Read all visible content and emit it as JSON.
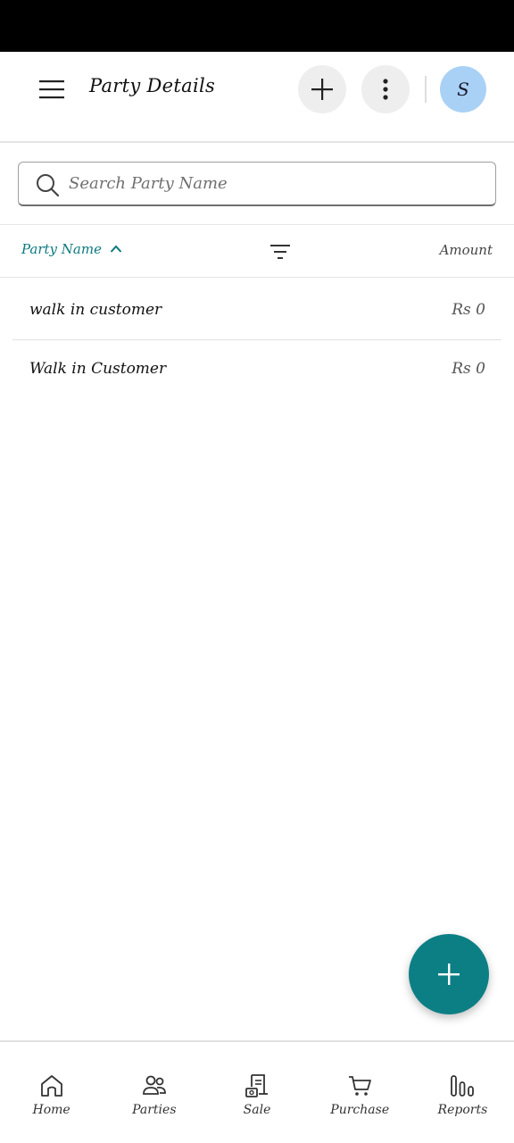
{
  "app_bar": {
    "title": "Party Details",
    "avatar_initial": "S",
    "avatar_color": "#a9d1f5"
  },
  "icons": {
    "menu": "hamburger-menu-icon",
    "add": "plus-icon",
    "more": "vertical-dots-icon",
    "search": "search-icon",
    "sort": "chevron-up-icon",
    "filter": "filter-lines-icon",
    "fab": "plus-icon"
  },
  "search": {
    "placeholder": "Search Party Name",
    "value": ""
  },
  "list_header": {
    "name_column": "Party Name",
    "amount_column": "Amount"
  },
  "parties": [
    {
      "name": "walk in customer",
      "amount": "Rs 0"
    },
    {
      "name": "Walk in Customer",
      "amount": "Rs 0"
    }
  ],
  "bottom_nav": {
    "items": [
      {
        "label": "Home",
        "icon": "home-icon"
      },
      {
        "label": "Parties",
        "icon": "parties-icon"
      },
      {
        "label": "Sale",
        "icon": "sale-receipt-icon"
      },
      {
        "label": "Purchase",
        "icon": "cart-icon"
      },
      {
        "label": "Reports",
        "icon": "reports-bars-icon"
      }
    ]
  },
  "colors": {
    "accent": "#0c7f85",
    "status_bar": "#000000",
    "fab": "#0c7f85"
  }
}
